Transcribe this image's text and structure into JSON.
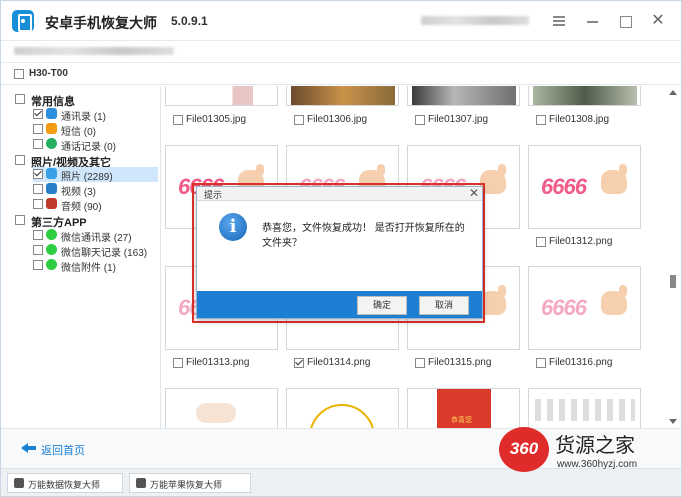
{
  "app": {
    "title": "安卓手机恢复大师",
    "version": "5.0.9.1"
  },
  "device": {
    "name": "H30-T00",
    "checked": false
  },
  "sidebar": {
    "categories": [
      {
        "label": "常用信息",
        "items": [
          {
            "label": "通讯录 (1)",
            "checked": true,
            "icon": "contacts-icon",
            "color": "#2d8fe0"
          },
          {
            "label": "短信 (0)",
            "checked": false,
            "icon": "sms-icon",
            "color": "#f39c12"
          },
          {
            "label": "通话记录 (0)",
            "checked": false,
            "icon": "call-log-icon",
            "color": "#27ae60"
          }
        ]
      },
      {
        "label": "照片/视频及其它",
        "items": [
          {
            "label": "照片 (2289)",
            "checked": true,
            "icon": "photos-icon",
            "color": "#3aa0e8"
          },
          {
            "label": "视频 (3)",
            "checked": false,
            "icon": "video-icon",
            "color": "#2b7fc6"
          },
          {
            "label": "音频 (90)",
            "checked": false,
            "icon": "audio-icon",
            "color": "#c0392b"
          }
        ]
      },
      {
        "label": "第三方APP",
        "items": [
          {
            "label": "微信通讯录 (27)",
            "checked": false,
            "icon": "wechat-icon",
            "color": "#2ecc40"
          },
          {
            "label": "微信聊天记录 (163)",
            "checked": false,
            "icon": "wechat-icon",
            "color": "#2ecc40"
          },
          {
            "label": "微信附件 (1)",
            "checked": false,
            "icon": "wechat-icon",
            "color": "#2ecc40"
          }
        ]
      }
    ]
  },
  "files": {
    "row1": [
      "File01305.jpg",
      "File01306.jpg",
      "File01307.jpg",
      "File01308.jpg"
    ],
    "row2_visible": [
      "File01312.png"
    ],
    "row3": [
      "File01313.png",
      "File01314.png",
      "File01315.png",
      "File01316.png"
    ],
    "row3_checked": [
      false,
      true,
      false,
      false
    ],
    "thumb_text": "6666"
  },
  "dialog": {
    "title": "提示",
    "message": "恭喜您，文件恢复成功！ 是否打开恢复所在的文件夹？",
    "confirm_label": "确定",
    "cancel_label": "取消",
    "accent": "#1d7fd3",
    "highlight": "#e0312b"
  },
  "bottom": {
    "back_label": "返回首页"
  },
  "footer": {
    "tabs": [
      "万能数据恢复大师",
      "万能苹果恢复大师"
    ]
  },
  "watermark": {
    "logo_text": "360",
    "name": "货源之家",
    "url": "www.360hyzj.com"
  },
  "red_card_text": "恭喜您"
}
